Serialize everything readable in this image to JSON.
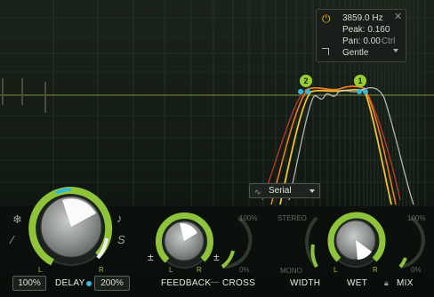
{
  "popup": {
    "frequency": "3859.0 Hz",
    "peak": "Peak: 0.160",
    "pan": "Pan: 0.00",
    "pan_modifier": "Ctrl",
    "slope": "Gentle",
    "power_icon": "power-icon",
    "close_icon": "close-icon",
    "dropdown_icon": "chevron-down-icon"
  },
  "bands": [
    {
      "label": "2",
      "accent": "#9acd32"
    },
    {
      "label": "1",
      "accent": "#9acd32"
    }
  ],
  "routing": {
    "selected": "Serial"
  },
  "delay": {
    "left_value": "100%",
    "label": "DELAY",
    "right_value": "200%",
    "channel_l": "L",
    "channel_r": "R"
  },
  "feedback": {
    "label": "FEEDBACK",
    "connector": "—",
    "cross_label": "CROSS",
    "scale_top": "100%",
    "scale_bottom": "0%",
    "channel_l": "L",
    "channel_r": "R"
  },
  "stereo": {
    "top_label": "STEREO",
    "bottom_label": "MONO",
    "width_label": "WIDTH"
  },
  "wet": {
    "label": "WET",
    "channel_l": "L",
    "channel_r": "R",
    "scale_top": "100%",
    "scale_bottom": "0%",
    "mix_label": "MIX"
  },
  "left_tools": {
    "snowflake": "snowflake-icon",
    "wand": "wand-icon",
    "note": "note-icon",
    "sync": "s-curve-icon"
  },
  "colors": {
    "accent_green": "#8fc43a",
    "accent_cyan": "#35b8d6",
    "curve_red": "#c0392b",
    "curve_orange": "#e67e22",
    "curve_yellow": "#f1c232",
    "curve_white": "#d9d9d9"
  }
}
